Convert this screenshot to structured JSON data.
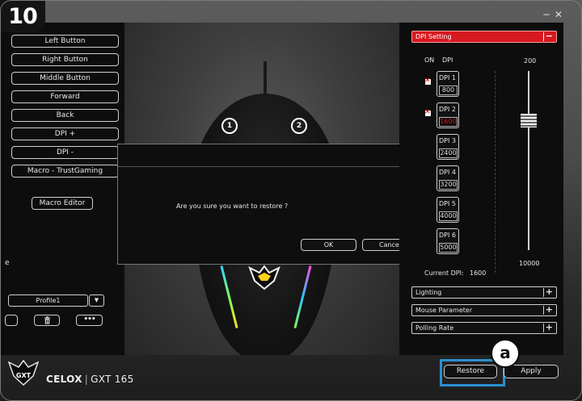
{
  "step_badge": "10",
  "window_controls": {
    "minimize": "−",
    "close": "✕"
  },
  "left_panel": {
    "buttons": [
      "Left Button",
      "Right Button",
      "Middle Button",
      "Forward",
      "Back",
      "DPI +",
      "DPI -",
      "Macro - TrustGaming"
    ],
    "macro_editor": "Macro Editor",
    "profile_label": "e",
    "profile_value": "Profile1",
    "profile_arrow": "▼",
    "more_label": "•••"
  },
  "mouse": {
    "markers": [
      "1",
      "2"
    ]
  },
  "dialog": {
    "message": "Are you sure you want to restore ?",
    "ok": "OK",
    "cancel": "Cancel",
    "close": "✕"
  },
  "dpi_panel": {
    "header": "DPI Setting",
    "header_toggle": "−",
    "col_on": "ON",
    "col_dpi": "DPI",
    "max": "200",
    "min": "10000",
    "current_label": "Current DPI:",
    "current_value": "1600",
    "checkbox_mark": "✕",
    "levels": [
      {
        "name": "DPI 1",
        "value": "800",
        "checked": true
      },
      {
        "name": "DPI 2",
        "value": "1600",
        "checked": true,
        "active": true
      },
      {
        "name": "DPI 3",
        "value": "2400",
        "checked": true
      },
      {
        "name": "DPI 4",
        "value": "3200",
        "checked": false
      },
      {
        "name": "DPI 5",
        "value": "4000",
        "checked": false
      },
      {
        "name": "DPI 6",
        "value": "5000",
        "checked": false
      }
    ]
  },
  "sections": [
    {
      "label": "Lighting",
      "toggle": "+"
    },
    {
      "label": "Mouse Parameter",
      "toggle": "+"
    },
    {
      "label": "Polling Rate",
      "toggle": "+"
    }
  ],
  "footer": {
    "restore": "Restore",
    "apply": "Apply",
    "step_marker": "a",
    "brand_model": "CELOX",
    "brand_sep": "|",
    "brand_name": "GXT 165",
    "logo_text": "GXT"
  },
  "colors": {
    "accent": "#d71920",
    "highlight": "#2c8fd0",
    "panel": "#0d0d0d"
  }
}
